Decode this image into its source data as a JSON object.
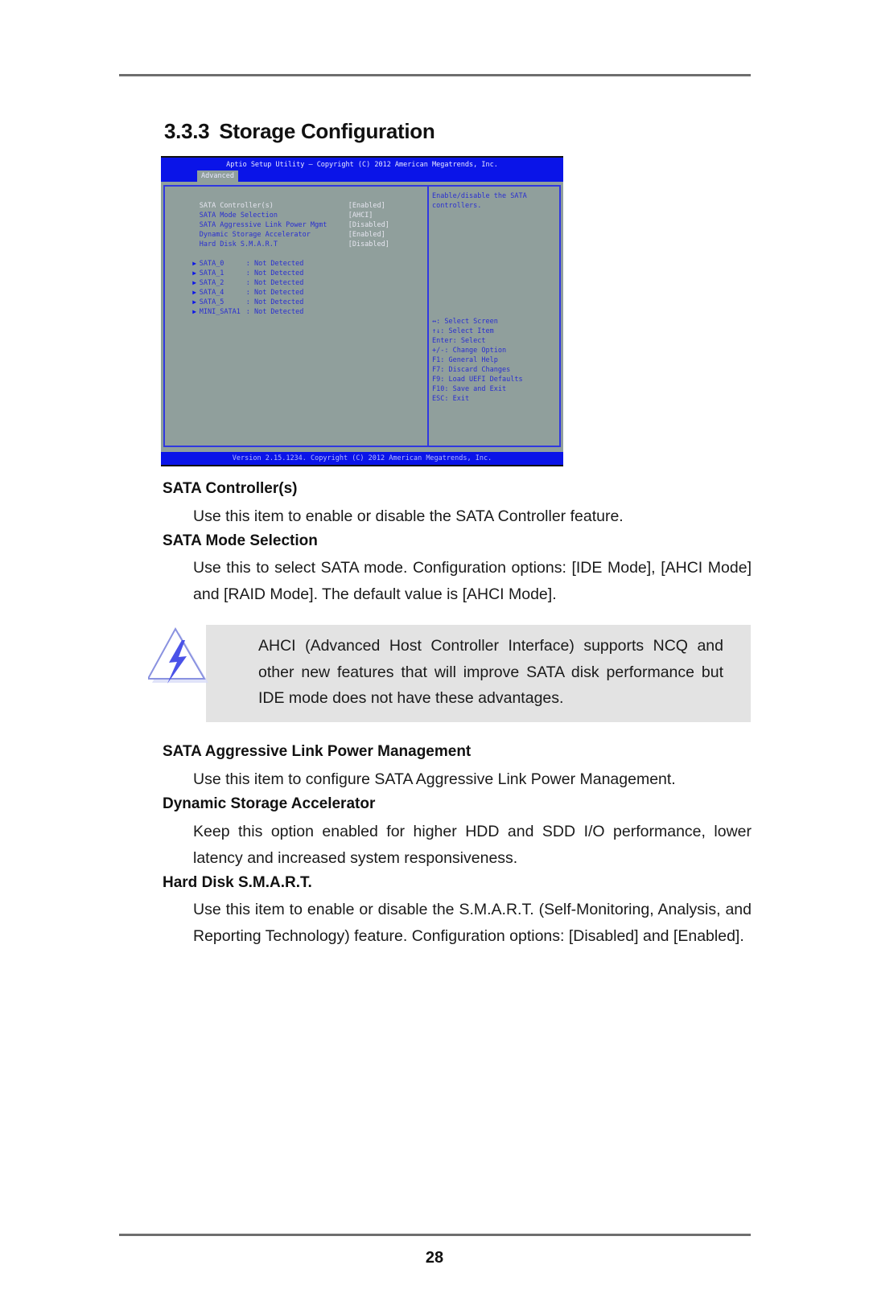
{
  "section": {
    "number": "3.3.3",
    "title": "Storage Configuration"
  },
  "bios": {
    "title": "Aptio Setup Utility – Copyright (C) 2012 American Megatrends, Inc.",
    "active_tab": "Advanced",
    "settings": [
      {
        "label": "SATA Controller(s)",
        "value": "[Enabled]",
        "selected": true
      },
      {
        "label": "SATA Mode Selection",
        "value": "[AHCI]",
        "selected": false
      },
      {
        "label": "SATA Aggressive Link Power Mgmt",
        "value": "[Disabled]",
        "selected": false
      },
      {
        "label": "Dynamic Storage Accelerator",
        "value": "[Enabled]",
        "selected": false
      },
      {
        "label": "Hard Disk S.M.A.R.T",
        "value": "[Disabled]",
        "selected": false
      }
    ],
    "ports": [
      {
        "name": "SATA_0",
        "status": ": Not Detected"
      },
      {
        "name": "SATA_1",
        "status": ": Not Detected"
      },
      {
        "name": "SATA_2",
        "status": ": Not Detected"
      },
      {
        "name": "SATA_4",
        "status": ": Not Detected"
      },
      {
        "name": "SATA_5",
        "status": ": Not Detected"
      },
      {
        "name": "MINI_SATA1",
        "status": ": Not Detected"
      }
    ],
    "help_text": [
      "Enable/disable the SATA",
      "controllers."
    ],
    "key_help": [
      "↔: Select Screen",
      "↑↓: Select Item",
      "Enter: Select",
      "+/-: Change Option",
      "F1: General Help",
      "F7: Discard Changes",
      "F9: Load UEFI Defaults",
      "F10: Save and Exit",
      "ESC: Exit"
    ],
    "footer": "Version 2.15.1234. Copyright (C) 2012 American Megatrends, Inc."
  },
  "items": [
    {
      "heading": "SATA Controller(s)",
      "text": "Use this item to enable or disable the SATA Controller feature."
    },
    {
      "heading": "SATA Mode Selection",
      "text": "Use this to select SATA mode. Configuration options: [IDE Mode], [AHCI Mode] and [RAID Mode]. The default value is [AHCI Mode]."
    },
    {
      "heading": "SATA Aggressive Link Power Management",
      "text": "Use this item to configure SATA Aggressive Link Power Management."
    },
    {
      "heading": "Dynamic Storage Accelerator",
      "text": "Keep this option enabled for higher HDD and SDD I/O performance, lower latency and increased system responsiveness."
    },
    {
      "heading": "Hard Disk S.M.A.R.T.",
      "text": "Use this item to enable or disable the S.M.A.R.T. (Self-Monitoring, Analysis, and Reporting Technology) feature. Configuration options: [Disabled] and [Enabled]."
    }
  ],
  "note": {
    "icon": "warning-lightning-icon",
    "text": "AHCI (Advanced Host Controller Interface) supports NCQ and other new features that will improve SATA disk performance but IDE mode does not have these advantages."
  },
  "page_number": "28"
}
